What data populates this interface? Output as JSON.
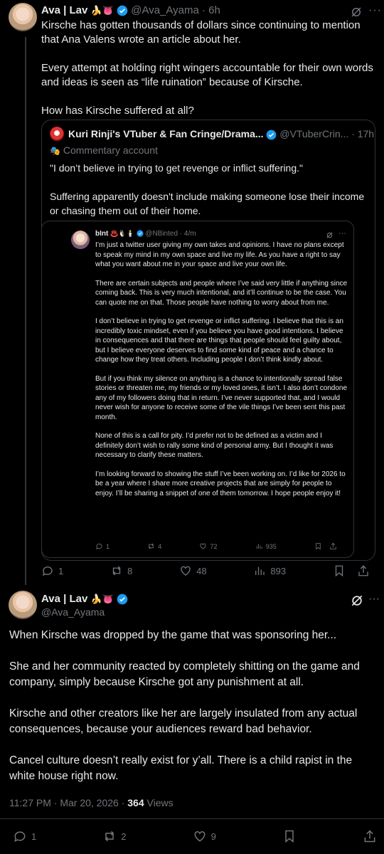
{
  "tweet1": {
    "name": "Ava | Lav",
    "emojis": "🍌👅",
    "handle": "@Ava_Ayama",
    "time": "· 6h",
    "paragraphs": [
      "Kirsche has gotten thousands of dollars since continuing to mention that Ana Valens wrote an article about her.",
      "Every attempt at holding right wingers accountable for their own words and ideas is seen as “life ruination” because of Kirsche.",
      "How has Kirsche suffered at all?"
    ],
    "actions": {
      "replies": "1",
      "reposts": "8",
      "likes": "48",
      "views": "893"
    }
  },
  "quote": {
    "name": "Kuri Rinji's VTuber & Fan Cringe/Drama...",
    "handle": "@VTuberCrin...",
    "time": "· 17h",
    "label": "Commentary account",
    "paragraphs": [
      "\"I don’t believe in trying to get revenge or inflict suffering.\"",
      "Suffering apparently doesn't include making someone lose their income or chasing them out of their home."
    ]
  },
  "inner": {
    "name": "bInt",
    "emojis": "♨️🐧🕯️",
    "handle": "@NBinted · 4/m",
    "paragraphs": [
      "I’m just a twitter user giving my own takes and opinions. I have no plans except to speak my mind in my own space and live my life. As you have a right to say what you want about me in your space and live your own life.",
      "There are certain subjects and people where I’ve said very little if anything since coming back. This is very much intentional, and it’ll continue to be the case. You can quote me on that. Those people have nothing to worry about from me.",
      "I don’t believe in trying to get revenge or inflict suffering. I believe that this is an incredibly toxic mindset, even if you believe you have good intentions. I believe in consequences and that there are things that people should feel guilty about, but I believe everyone deserves to find some kind of peace and a chance to change how they treat others. Including people I don’t think kindly about.",
      "But if you think my silence on anything is a chance to intentionally spread false stories or threaten me, my friends or my loved ones, it isn’t. I also don’t condone any of my followers doing that in return. I’ve never supported that, and I would never wish for anyone to receive some of the vile things I’ve been sent this past month.",
      "None of this is a call for pity. I’d prefer not to be defined as a victim and I definitely don’t wish to rally some kind of personal army. But I thought it was necessary to clarify these matters.",
      "I’m looking forward to showing the stuff I’ve been working on. I’d like for 2026 to be a year where I share more creative projects that are simply for people to enjoy. I’ll be sharing a snippet of one of them tomorrow. I hope people enjoy it!"
    ],
    "actions": {
      "replies": "1",
      "reposts": "4",
      "likes": "72",
      "views": "935"
    }
  },
  "tweet2": {
    "name": "Ava | Lav",
    "emojis": "🍌👅",
    "handle": "@Ava_Ayama",
    "paragraphs": [
      "When Kirsche was dropped by the game that was sponsoring her...",
      "She and her community reacted by completely shitting on the game and company, simply because Kirsche got any punishment at all.",
      "Kirsche and other creators like her are largely insulated from any actual consequences, because your audiences reward bad behavior.",
      "Cancel culture doesn’t really exist for y’all. There is a child rapist in the white house right now."
    ],
    "timestamp": "11:27 PM · Mar 20, 2026 · ",
    "views_count": "364",
    "views_label": " Views",
    "actions": {
      "replies": "1",
      "reposts": "2",
      "likes": "9"
    }
  },
  "colors": {
    "background": "#000000",
    "text": "#e7e9ea",
    "muted": "#71767b",
    "verified": "#1d9bf0",
    "border": "#2f3336"
  }
}
